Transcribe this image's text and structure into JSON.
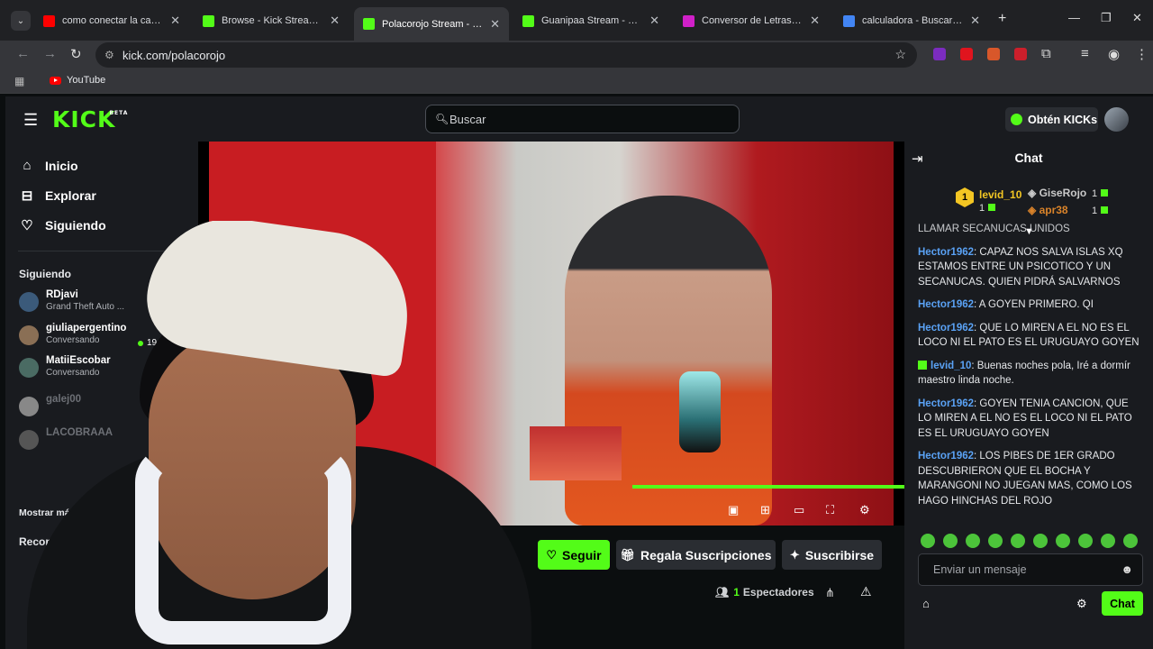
{
  "browser": {
    "tabs": [
      {
        "title": "como conectar la camara d",
        "color": "#ff0000"
      },
      {
        "title": "Browse - Kick Streaming",
        "color": "#53fc18"
      },
      {
        "title": "Polacorojo Stream - Wa",
        "color": "#53fc18",
        "active": true
      },
      {
        "title": "Guanipaa Stream - Watch l",
        "color": "#53fc18"
      },
      {
        "title": "Conversor de Letras Cursiv",
        "color": "#d020c8"
      },
      {
        "title": "calculadora - Buscar con G",
        "color": "#4285f4"
      }
    ],
    "url": "kick.com/polacorojo",
    "bookmarks": [
      {
        "label": "YouTube"
      }
    ]
  },
  "header": {
    "logo": "KICK",
    "logo_beta": "BETA",
    "search_placeholder": "Buscar",
    "kicks_label": "Obtén KICKs"
  },
  "sidebar": {
    "nav": [
      {
        "label": "Inicio",
        "icon": "home-icon"
      },
      {
        "label": "Explorar",
        "icon": "compass-icon"
      },
      {
        "label": "Siguiendo",
        "icon": "heart-icon"
      }
    ],
    "following_heading": "Siguiendo",
    "following": [
      {
        "name": "RDjavi",
        "sub": "Grand Theft Auto ...",
        "viewers": "19"
      },
      {
        "name": "giuliapergentino",
        "sub": "Conversando"
      },
      {
        "name": "MatiiEscobar",
        "sub": "Conversando"
      },
      {
        "name": "galej00",
        "sub": ""
      },
      {
        "name": "LACOBRAAA",
        "sub": ""
      }
    ],
    "show_more": "Mostrar más",
    "recommended_heading": "Recome"
  },
  "stream": {
    "follow_label": "Seguir",
    "gift_label": "Regala Suscripciones",
    "subscribe_label": "Suscribirse",
    "viewer_count": "1",
    "viewer_label": "Espectadores"
  },
  "chat": {
    "title": "Chat",
    "leaderboard": [
      {
        "rank": "1",
        "name": "levid_10",
        "count": "1",
        "color": "#f3c623"
      },
      {
        "rank": "2",
        "name": "GiseRojo",
        "count": "1",
        "color": "#c0c0c0"
      },
      {
        "rank": "3",
        "name": "apr38",
        "count": "1",
        "color": "#d9832a"
      }
    ],
    "messages": [
      {
        "user": "",
        "text": "LLAMAR SECANUCAS UNIDOS"
      },
      {
        "user": "Hector1962",
        "text": "CAPAZ NOS SALVA ISLAS XQ ESTAMOS ENTRE UN PSICOTICO Y UN SECANUCAS. QUIEN PIDRÁ SALVARNOS"
      },
      {
        "user": "Hector1962",
        "text": "A GOYEN PRIMERO. QI"
      },
      {
        "user": "Hector1962",
        "text": "QUE LO MIREN A EL NO ES EL LOCO NI EL PATO ES EL URUGUAYO GOYEN"
      },
      {
        "user": "levid_10",
        "text": "Buenas noches pola, Iré a dormír maestro linda noche.",
        "sub": true
      },
      {
        "user": "Hector1962",
        "text": "GOYEN TENIA CANCION, QUE LO MIREN A EL NO ES EL LOCO NI EL PATO ES EL URUGUAYO GOYEN"
      },
      {
        "user": "Hector1962",
        "text": "LOS PIBES DE 1ER GRADO DESCUBRIERON QUE EL BOCHA Y MARANGONI NO JUEGAN MAS, COMO LOS HAGO HINCHAS DEL ROJO"
      }
    ],
    "input_placeholder": "Enviar un mensaje",
    "send_label": "Chat"
  }
}
